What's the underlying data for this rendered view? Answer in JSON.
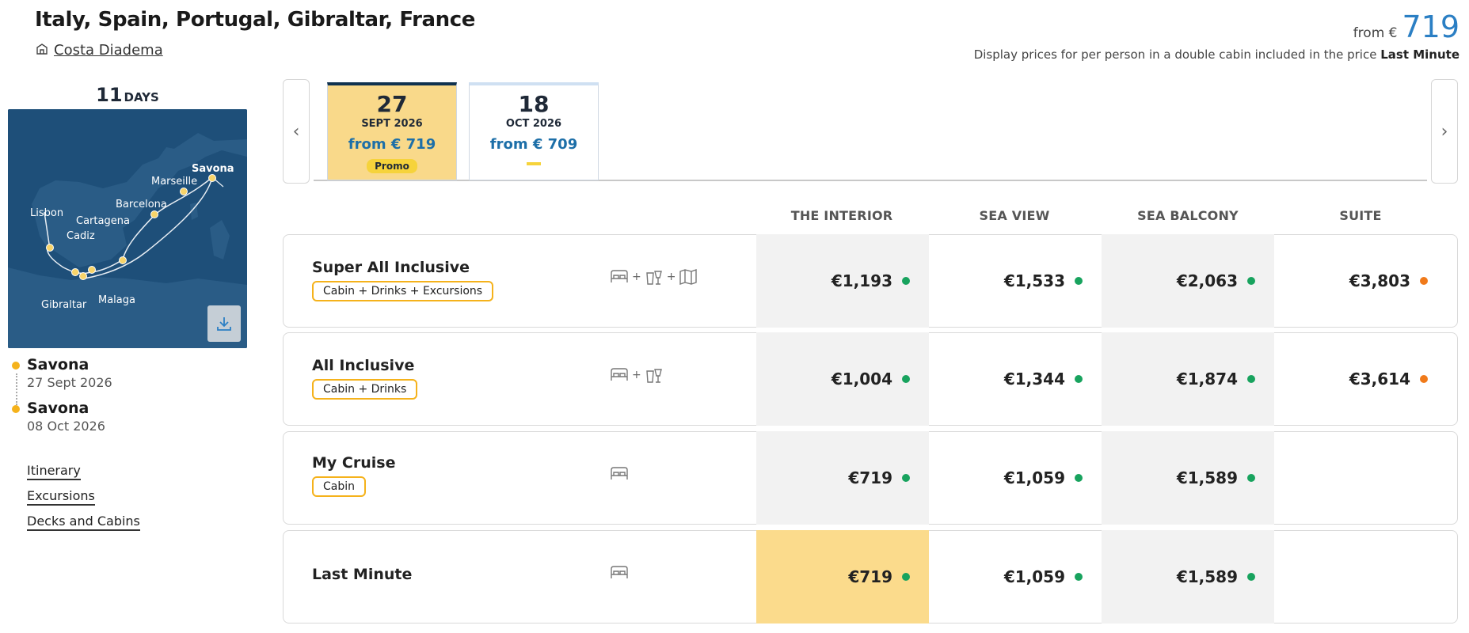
{
  "header": {
    "title": "Italy, Spain, Portugal, Gibraltar, France",
    "ship_name": "Costa Diadema",
    "from_label": "from €",
    "from_price": "719",
    "display_note": "Display prices for per person in a double cabin included in the price",
    "display_note_bold": "Last Minute"
  },
  "duration": {
    "number": "11",
    "unit": "DAYS"
  },
  "map": {
    "labels": [
      "Savona",
      "Marseille",
      "Barcelona",
      "Cartagena",
      "Lisbon",
      "Cadiz",
      "Gibraltar",
      "Malaga"
    ]
  },
  "itinerary": {
    "start": {
      "port": "Savona",
      "date": "27 Sept 2026"
    },
    "end": {
      "port": "Savona",
      "date": "08 Oct 2026"
    }
  },
  "links": [
    "Itinerary",
    "Excursions",
    "Decks and Cabins"
  ],
  "dates": [
    {
      "day": "27",
      "month": "SEPT 2026",
      "price": "from € 719",
      "badge": "Promo"
    },
    {
      "day": "18",
      "month": "OCT 2026",
      "price": "from € 709"
    }
  ],
  "columns": [
    "THE INTERIOR",
    "SEA VIEW",
    "SEA BALCONY",
    "SUITE"
  ],
  "rows": [
    {
      "name": "Super All Inclusive",
      "tag": "Cabin + Drinks + Excursions",
      "icons": [
        "bed-icon",
        "drinks-icon",
        "map-icon"
      ],
      "prices": [
        "€1,193",
        "€1,533",
        "€2,063",
        "€3,803"
      ],
      "status": [
        "green",
        "green",
        "green",
        "orange"
      ]
    },
    {
      "name": "All Inclusive",
      "tag": "Cabin + Drinks",
      "icons": [
        "bed-icon",
        "drinks-icon"
      ],
      "prices": [
        "€1,004",
        "€1,344",
        "€1,874",
        "€3,614"
      ],
      "status": [
        "green",
        "green",
        "green",
        "orange"
      ]
    },
    {
      "name": "My Cruise",
      "tag": "Cabin",
      "icons": [
        "bed-icon"
      ],
      "prices": [
        "€719",
        "€1,059",
        "€1,589",
        ""
      ],
      "status": [
        "green",
        "green",
        "green",
        ""
      ]
    },
    {
      "name": "Last Minute",
      "tag": "",
      "icons": [
        "bed-icon"
      ],
      "prices": [
        "€719",
        "€1,059",
        "€1,589",
        ""
      ],
      "status": [
        "green",
        "green",
        "green",
        ""
      ]
    }
  ],
  "colors": {
    "accent_blue": "#2b7fc4",
    "promo_yellow": "#f6d33b",
    "highlight": "#fbdb8c",
    "available": "#18a35e",
    "limited": "#f07a1a"
  }
}
